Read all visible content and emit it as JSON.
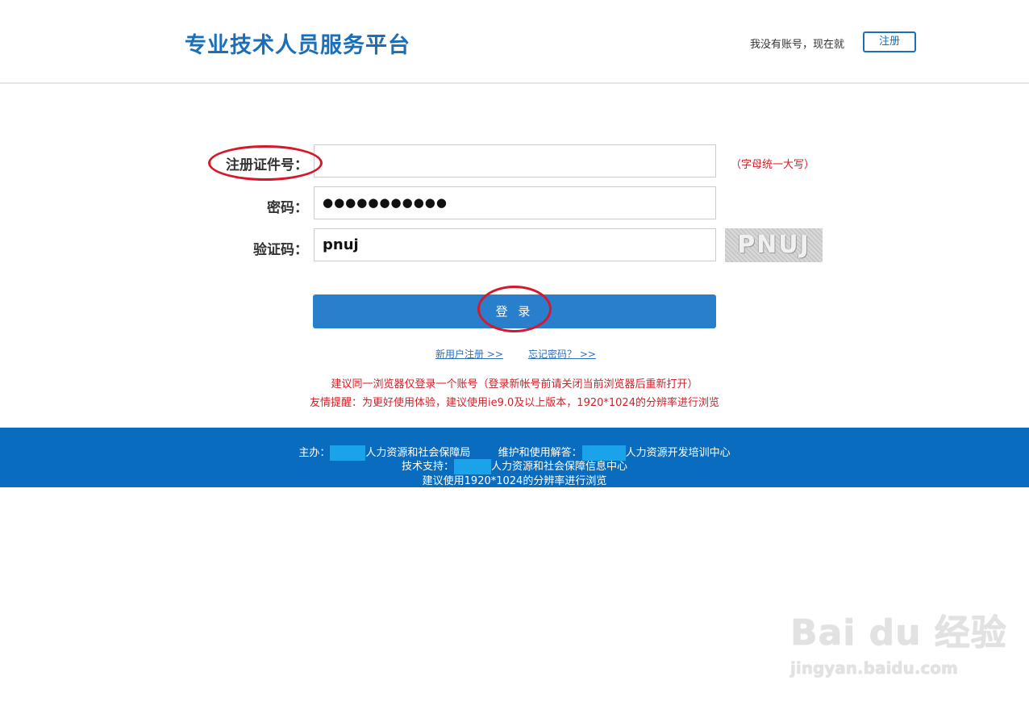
{
  "header": {
    "brand": "专业技术人员服务平台",
    "no_account_text": "我没有账号，现在就",
    "register_label": "注册"
  },
  "form": {
    "cert_label": "注册证件号：",
    "cert_value": "",
    "cert_hint": "（字母统一大写）",
    "password_label": "密码：",
    "password_value": "●●●●●●●●●●●",
    "captcha_label": "验证码：",
    "captcha_value": "pnuj",
    "captcha_image_text": "PNUJ",
    "login_label": "登 录",
    "new_user_link": "新用户注册 >>",
    "forgot_link": "忘记密码？ >>"
  },
  "notices": [
    "建议同一浏览器仅登录一个账号（登录新帐号前请关闭当前浏览器后重新打开）",
    "友情提醒：为更好使用体验，建议使用ie9.0及以上版本，1920*1024的分辨率进行浏览"
  ],
  "footer": {
    "host_prefix": "主办：",
    "host_suffix": "人力资源和社会保障局",
    "support_prefix": "维护和使用解答：",
    "support_suffix": "人力资源开发培训中心",
    "tech_prefix": "技术支持：",
    "tech_suffix": "人力资源和社会保障信息中心",
    "resolution": "建议使用1920*1024的分辨率进行浏览"
  },
  "watermark": {
    "main": "Bai du 经验",
    "url": "jingyan.baidu.com"
  },
  "colors": {
    "brand": "#1a6fb8",
    "button": "#2a7fcc",
    "footer": "#0a6cbf",
    "alert": "#d2212a"
  }
}
